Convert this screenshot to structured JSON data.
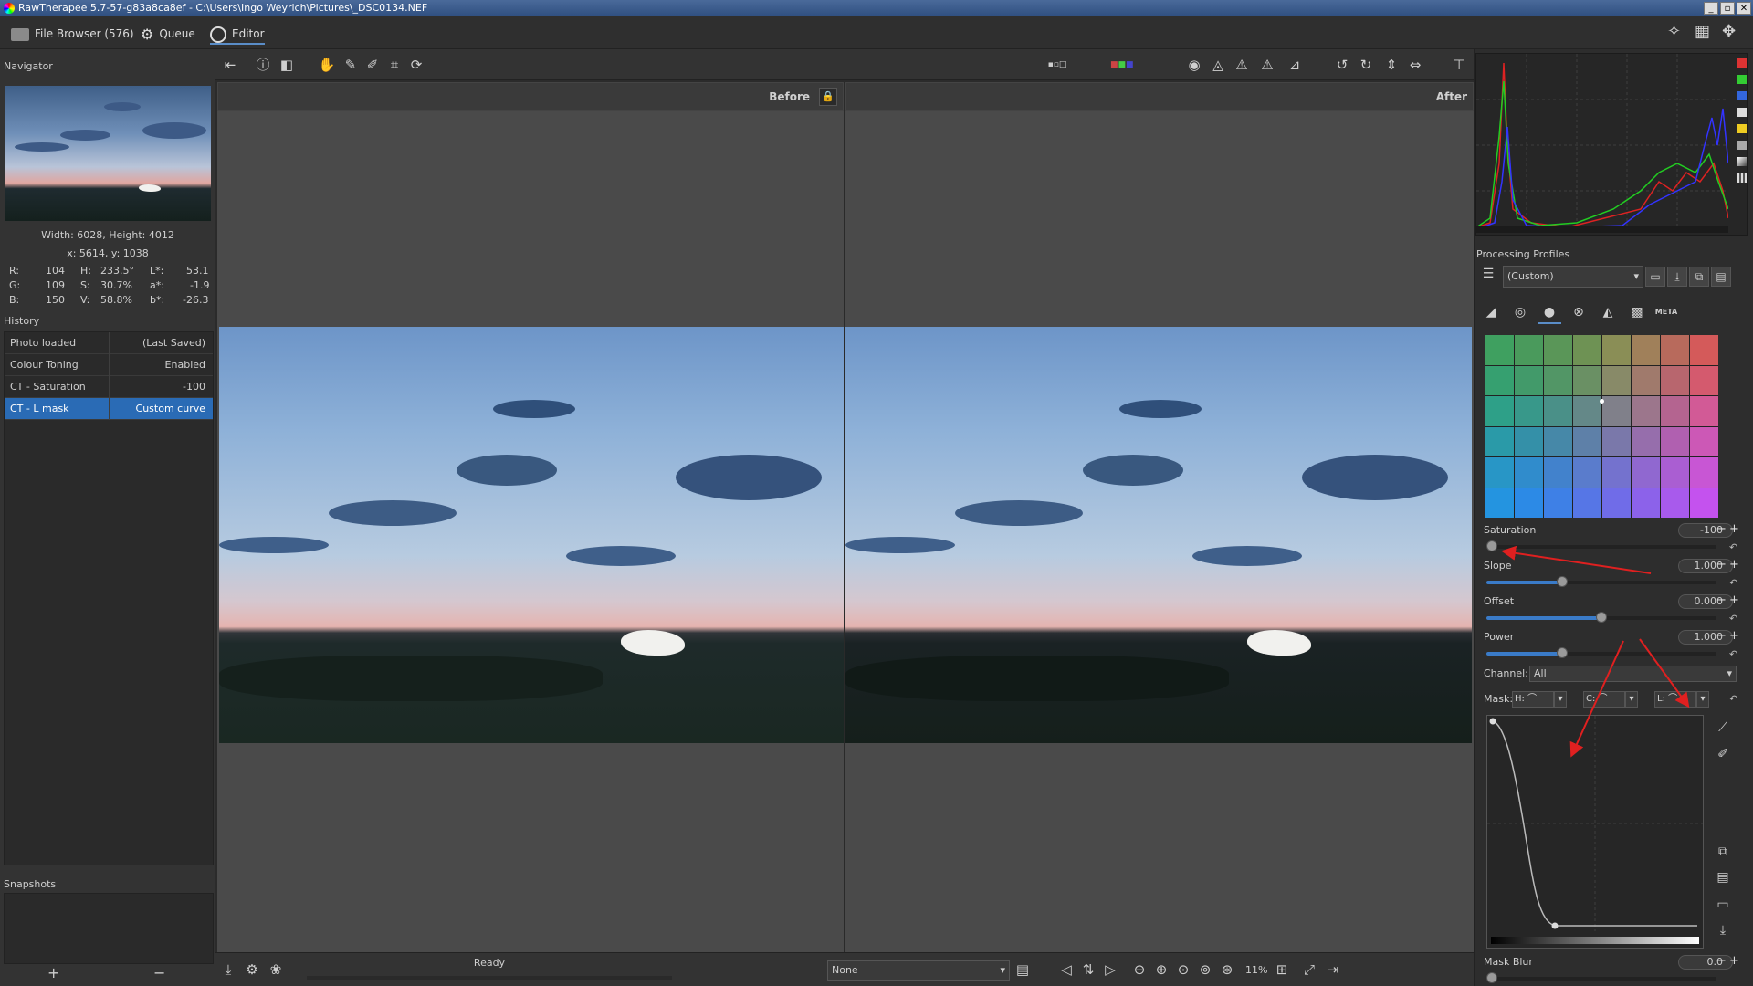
{
  "window": {
    "title": "RawTherapee 5.7-57-g83a8ca8ef - C:\\Users\\Ingo Weyrich\\Pictures\\_DSC0134.NEF"
  },
  "tabs": {
    "file_browser": "File Browser (576)",
    "queue": "Queue",
    "editor": "Editor"
  },
  "navigator": {
    "title": "Navigator",
    "size": "Width: 6028, Height: 4012",
    "coords": "x: 5614, y: 1038",
    "r_label": "R:",
    "r": "104",
    "g_label": "G:",
    "g": "109",
    "b_label": "B:",
    "b": "150",
    "h_label": "H:",
    "h": "233.5°",
    "s_label": "S:",
    "s": "30.7%",
    "v_label": "V:",
    "v": "58.8%",
    "l_label": "L*:",
    "l": "53.1",
    "a_label": "a*:",
    "a": "-1.9",
    "bb_label": "b*:",
    "bb": "-26.3"
  },
  "history": {
    "title": "History",
    "items": [
      {
        "label": "Photo loaded",
        "value": "(Last Saved)"
      },
      {
        "label": "Colour Toning",
        "value": "Enabled"
      },
      {
        "label": "CT - Saturation",
        "value": "-100"
      },
      {
        "label": "CT - L mask",
        "value": "Custom curve"
      }
    ]
  },
  "snapshots": {
    "title": "Snapshots",
    "add": "+",
    "remove": "−"
  },
  "preview": {
    "before": "Before",
    "after": "After"
  },
  "statusbar": {
    "status": "Ready",
    "none_select": "None",
    "zoom": "11%"
  },
  "profiles": {
    "title": "Processing Profiles",
    "current": "(Custom)"
  },
  "meta_tab": "META",
  "sliders": {
    "saturation": {
      "label": "Saturation",
      "value": "-100",
      "level": 0
    },
    "slope": {
      "label": "Slope",
      "value": "1.000",
      "level": 0.33
    },
    "offset": {
      "label": "Offset",
      "value": "0.000",
      "level": 0.5
    },
    "power": {
      "label": "Power",
      "value": "1.000",
      "level": 0.33
    },
    "mask_blur": {
      "label": "Mask Blur",
      "value": "0.0",
      "level": 0
    }
  },
  "channel": {
    "label": "Channel:",
    "value": "All"
  },
  "mask": {
    "label": "Mask:",
    "h": "H:",
    "c": "C:",
    "l": "L:"
  },
  "colors": {
    "accent": "#2a6bb5",
    "slider_fill": "#3a7bc8",
    "arrow": "#e02020"
  }
}
